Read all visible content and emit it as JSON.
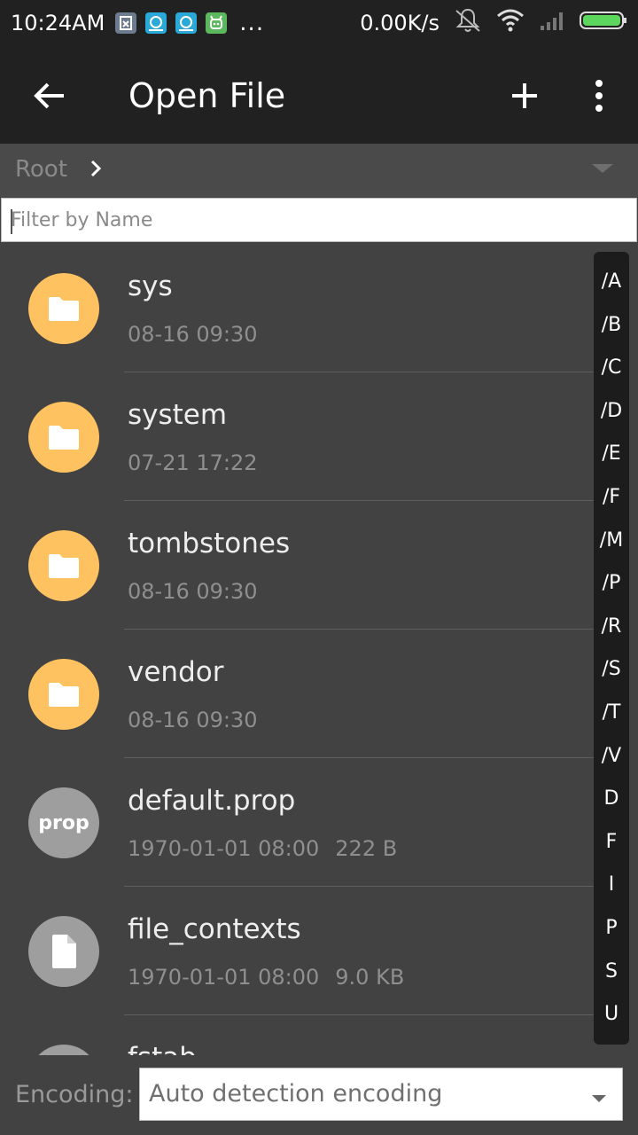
{
  "status_bar": {
    "time": "10:24AM",
    "app_icons": [
      "android-app-icon",
      "swirl-app-icon",
      "swirl-app-icon",
      "android-robot-icon"
    ],
    "more": "...",
    "net_speed": "0.00K/s"
  },
  "appbar": {
    "title": "Open File"
  },
  "breadcrumb": {
    "root": "Root"
  },
  "filter": {
    "placeholder": "Filter by Name",
    "value": ""
  },
  "files": [
    {
      "name": "sys",
      "date": "08-16 09:30",
      "size": "",
      "type": "folder"
    },
    {
      "name": "system",
      "date": "07-21 17:22",
      "size": "",
      "type": "folder"
    },
    {
      "name": "tombstones",
      "date": "08-16 09:30",
      "size": "",
      "type": "folder"
    },
    {
      "name": "vendor",
      "date": "08-16 09:30",
      "size": "",
      "type": "folder"
    },
    {
      "name": "default.prop",
      "date": "1970-01-01 08:00",
      "size": "222 B",
      "type": "prop",
      "icon_text": "prop"
    },
    {
      "name": "file_contexts",
      "date": "1970-01-01 08:00",
      "size": "9.0 KB",
      "type": "file"
    },
    {
      "name": "fstab",
      "date": "",
      "size": "",
      "type": "file"
    }
  ],
  "index": [
    "/A",
    "/B",
    "/C",
    "/D",
    "/E",
    "/F",
    "/M",
    "/P",
    "/R",
    "/S",
    "/T",
    "/V",
    "D",
    "F",
    "I",
    "P",
    "S",
    "U"
  ],
  "encoding": {
    "label": "Encoding:",
    "value": "Auto detection encoding"
  },
  "colors": {
    "folder": "#ffc261",
    "file": "#9e9e9e",
    "toolbar": "#212121",
    "background": "#424242"
  }
}
